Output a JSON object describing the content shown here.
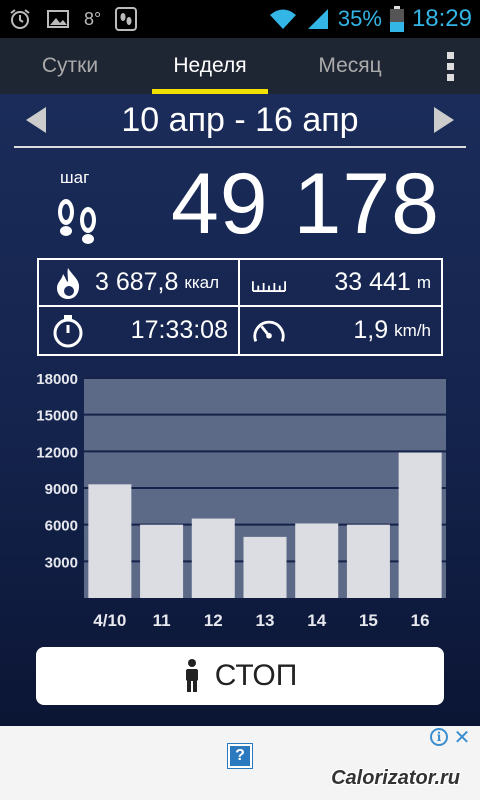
{
  "status_bar": {
    "temperature": "8°",
    "battery": "35%",
    "time": "18:29",
    "icons": [
      "alarm-icon",
      "gallery-icon",
      "pedometer-notification-icon",
      "wifi-icon",
      "signal-icon",
      "battery-icon"
    ]
  },
  "tabs": [
    {
      "label": "Сутки",
      "active": false
    },
    {
      "label": "Неделя",
      "active": true
    },
    {
      "label": "Месяц",
      "active": false
    }
  ],
  "date_range": "10 апр - 16 апр",
  "steps": {
    "label": "шаг",
    "value": "49 178"
  },
  "stats": {
    "calories": {
      "value": "3 687,8",
      "unit": "ккал"
    },
    "distance": {
      "value": "33 441",
      "unit": "m"
    },
    "duration": {
      "value": "17:33:08"
    },
    "speed": {
      "value": "1,9",
      "unit": "km/h"
    }
  },
  "chart_data": {
    "type": "bar",
    "categories": [
      "4/10",
      "11",
      "12",
      "13",
      "14",
      "15",
      "16"
    ],
    "values": [
      9300,
      6000,
      6500,
      5000,
      6100,
      6000,
      11900
    ],
    "ylim": [
      0,
      18000
    ],
    "yticks": [
      3000,
      6000,
      9000,
      12000,
      15000,
      18000
    ],
    "tick_labels": [
      "3000",
      "6000",
      "9000",
      "12000",
      "15000",
      "18000"
    ],
    "grid": true,
    "colors": {
      "bar": "#dcdde3",
      "plot_bg": "#5d6a87",
      "gridline": "#16224a"
    }
  },
  "stop_button": {
    "label": "СТОП"
  },
  "ad": {
    "placeholder_icon": "?",
    "info_icon": "i",
    "close_icon": "✕"
  },
  "watermark": "Calorizator.ru",
  "colors": {
    "accent": "#f2e100",
    "status_blue": "#33b5e5",
    "bg_top": "#1b2c5a",
    "bg_bottom": "#0b1534"
  }
}
